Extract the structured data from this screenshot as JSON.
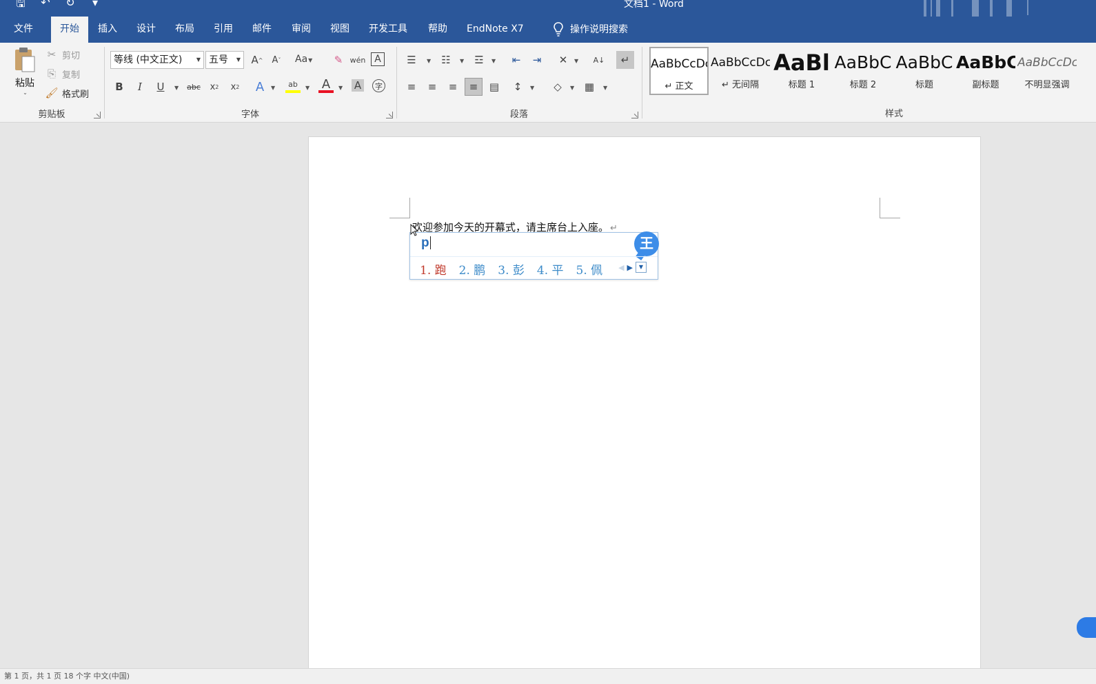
{
  "title_bar": {
    "doc_title": "文档1 - Word"
  },
  "tabs": [
    {
      "label": "文件"
    },
    {
      "label": "开始"
    },
    {
      "label": "插入"
    },
    {
      "label": "设计"
    },
    {
      "label": "布局"
    },
    {
      "label": "引用"
    },
    {
      "label": "邮件"
    },
    {
      "label": "审阅"
    },
    {
      "label": "视图"
    },
    {
      "label": "开发工具"
    },
    {
      "label": "帮助"
    },
    {
      "label": "EndNote X7"
    }
  ],
  "search_tab": {
    "label": "操作说明搜索"
  },
  "clipboard": {
    "paste": "粘贴",
    "cut": "剪切",
    "copy": "复制",
    "format_painter": "格式刷",
    "group_label": "剪贴板"
  },
  "font": {
    "font_name": "等线 (中文正文)",
    "font_size": "五号",
    "case_label": "Aa",
    "phonetic": "wén文",
    "group_label": "字体"
  },
  "paragraph": {
    "group_label": "段落"
  },
  "styles": {
    "group_label": "样式",
    "items": [
      {
        "sample": "AaBbCcDc",
        "name": "正文"
      },
      {
        "sample": "AaBbCcDc",
        "name": "无间隔"
      },
      {
        "sample": "AaBl",
        "name": "标题 1"
      },
      {
        "sample": "AaBbC",
        "name": "标题 2"
      },
      {
        "sample": "AaBbC",
        "name": "标题"
      },
      {
        "sample": "AaBbC",
        "name": "副标题"
      },
      {
        "sample": "AaBbCcDc",
        "name": "不明显强调"
      }
    ]
  },
  "document": {
    "text": "欢迎参加今天的开幕式，请主席台上入座。"
  },
  "ime": {
    "composition": "p",
    "badge": "王",
    "candidates": [
      "1. 跑",
      "2. 鹏",
      "3. 彭",
      "4. 平",
      "5. 佩"
    ]
  },
  "status_bar": {
    "text": "第 1 页，共 1 页    18 个字    中文(中国)"
  },
  "colors": {
    "accent": "#2b579a",
    "ime_blue": "#3d8de8",
    "highlight": "#ffff00",
    "font_color": "#e81123"
  }
}
